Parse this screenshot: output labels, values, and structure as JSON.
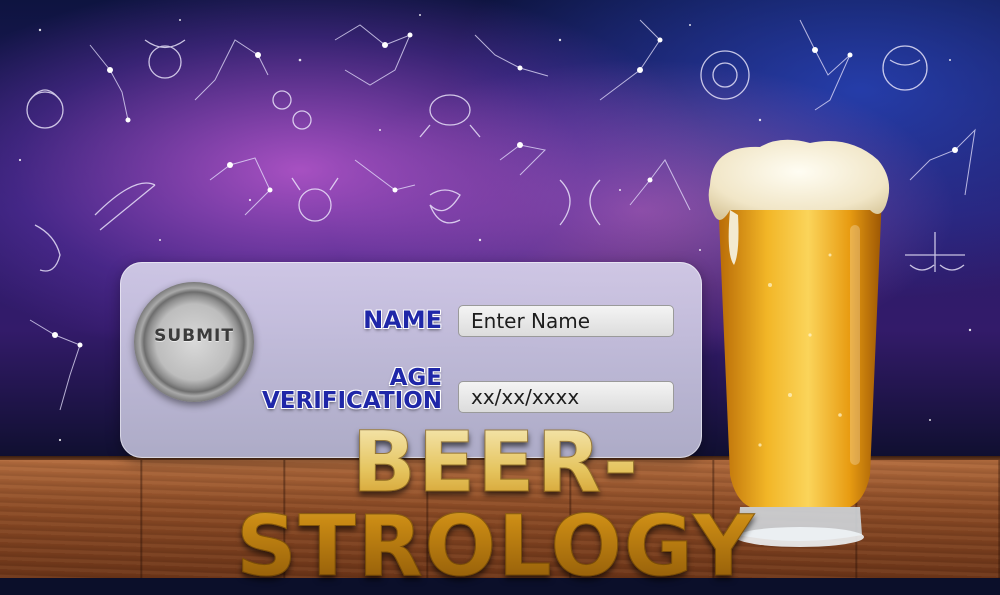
{
  "app": {
    "title": "BEER-STROLOGY"
  },
  "form": {
    "submit_label": "SUBMIT",
    "name_label": "NAME",
    "name_placeholder": "Enter Name",
    "age_label_line1": "AGE",
    "age_label_line2": "VERIFICATION",
    "age_placeholder": "xx/xx/xxxx"
  },
  "colors": {
    "label_blue": "#1f27a8",
    "title_gold": "#d9a020",
    "beer_amber": "#e8a115",
    "foam": "#f7f0dc"
  },
  "icons": {
    "submit": "bottle-cap-icon",
    "decoration": [
      "zodiac-constellation-icons",
      "beer-glass-icon"
    ]
  }
}
